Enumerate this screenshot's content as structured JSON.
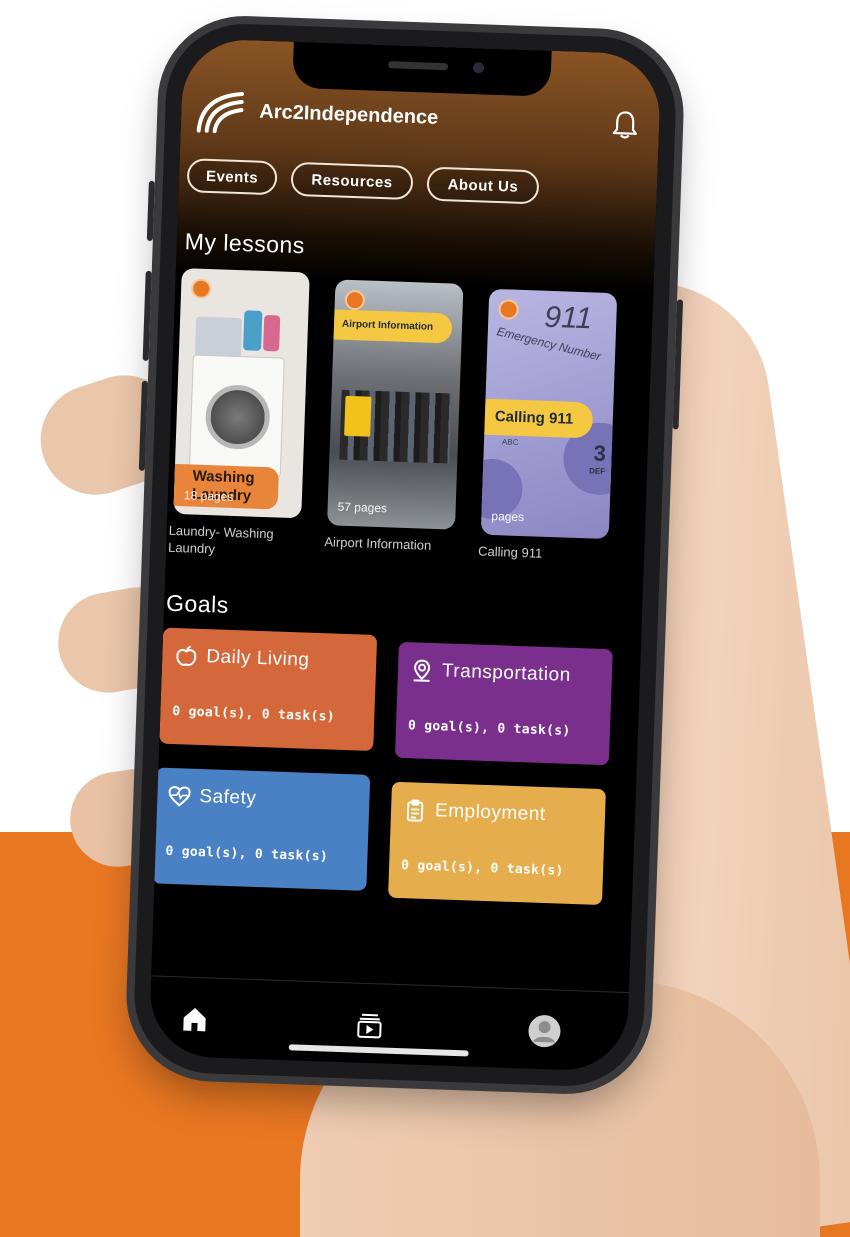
{
  "app": {
    "title": "Arc2Independence"
  },
  "nav_pills": [
    {
      "label": "Events"
    },
    {
      "label": "Resources"
    },
    {
      "label": "About Us"
    }
  ],
  "lessons": {
    "title": "My lessons",
    "items": [
      {
        "tag": "Washing Laundry",
        "pages": "18 pages",
        "caption": "Laundry- Washing Laundry"
      },
      {
        "tag": "Airport Information",
        "pages": "57 pages",
        "caption": "Airport Information"
      },
      {
        "tag": "Calling 911",
        "pages": "pages",
        "caption": "Calling 911",
        "screen_text_1": "911",
        "screen_text_2": "Emergency Number",
        "key_label": "DEF",
        "key_label_2": "ABC"
      }
    ]
  },
  "goals": {
    "title": "Goals",
    "items": [
      {
        "label": "Daily Living",
        "count": "0 goal(s), 0 task(s)",
        "color": "#d4683a",
        "icon": "apple-icon"
      },
      {
        "label": "Transportation",
        "count": "0 goal(s), 0 task(s)",
        "color": "#7b2f8c",
        "icon": "location-pin-icon"
      },
      {
        "label": "Safety",
        "count": "0 goal(s), 0 task(s)",
        "color": "#4a80c4",
        "icon": "heart-pulse-icon"
      },
      {
        "label": "Employment",
        "count": "0 goal(s), 0 task(s)",
        "color": "#e6ad4d",
        "icon": "clipboard-icon"
      }
    ]
  },
  "bottom_nav": [
    "home-icon",
    "video-library-icon",
    "profile-avatar-icon"
  ],
  "colors": {
    "accent_orange": "#e87722",
    "background": "#000000"
  }
}
